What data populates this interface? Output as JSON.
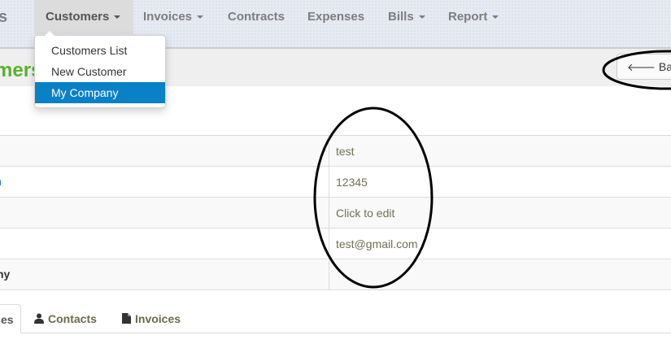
{
  "navbar": {
    "brand_fragment": "s",
    "items": [
      {
        "label": "Customers",
        "dropdown": true
      },
      {
        "label": "Invoices",
        "dropdown": true
      },
      {
        "label": "Contracts",
        "dropdown": false
      },
      {
        "label": "Expenses",
        "dropdown": false
      },
      {
        "label": "Bills",
        "dropdown": true
      },
      {
        "label": "Report",
        "dropdown": true
      }
    ]
  },
  "customers_menu": {
    "items": [
      "Customers List",
      "New Customer",
      "My Company"
    ],
    "active": "My Company"
  },
  "page": {
    "title_fragment": "mers",
    "back_label": "Back"
  },
  "details": {
    "rows": [
      {
        "label": "",
        "value": "test"
      },
      {
        "label": "n",
        "value": "12345"
      },
      {
        "label": "",
        "value": "Click to edit"
      },
      {
        "label": "",
        "value": "test@gmail.com"
      },
      {
        "label": "ny",
        "value": ""
      }
    ]
  },
  "tabs": {
    "active_fragment": "es",
    "contacts": "Contacts",
    "invoices": "Invoices"
  },
  "colors": {
    "accent_green": "#5ab12b",
    "dropdown_active": "#0a81c6",
    "link_blue": "#0a6ac4"
  }
}
